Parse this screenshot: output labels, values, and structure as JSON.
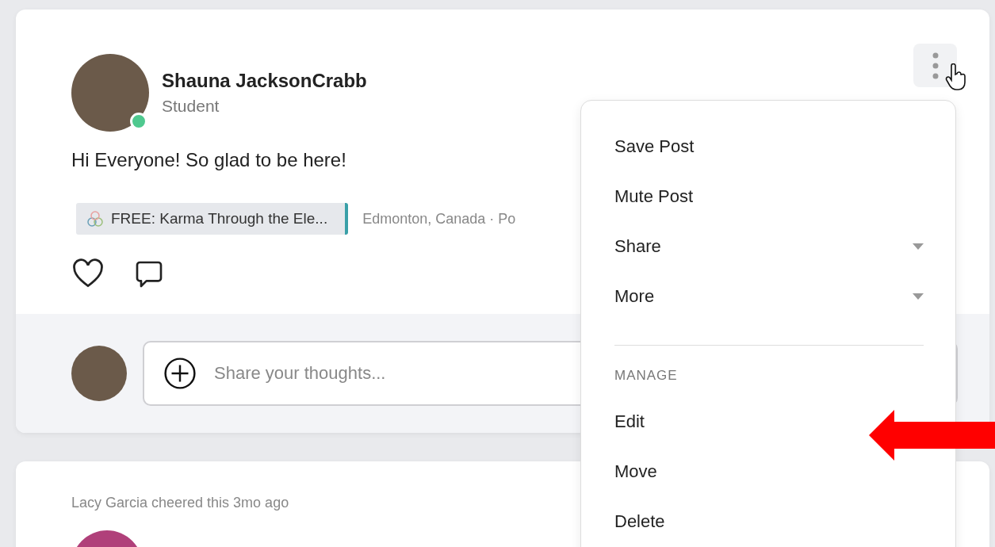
{
  "post": {
    "author": "Shauna JacksonCrabb",
    "role": "Student",
    "online": true,
    "text": "Hi Everyone! So glad to be here!",
    "course": "FREE: Karma Through the Ele...",
    "meta": "Edmonton, Canada · Po",
    "liked": false
  },
  "comment_box": {
    "placeholder": "Share your thoughts..."
  },
  "menu": {
    "open": true,
    "items": [
      {
        "kind": "item",
        "label": "Save Post"
      },
      {
        "kind": "item",
        "label": "Mute Post"
      },
      {
        "kind": "submenu",
        "label": "Share"
      },
      {
        "kind": "submenu",
        "label": "More"
      },
      {
        "kind": "divider"
      },
      {
        "kind": "heading",
        "label": "MANAGE"
      },
      {
        "kind": "item",
        "label": "Edit"
      },
      {
        "kind": "item",
        "label": "Move"
      },
      {
        "kind": "item",
        "label": "Delete"
      }
    ]
  },
  "next_post": {
    "activity": "Lacy Garcia cheered this 3mo ago"
  }
}
